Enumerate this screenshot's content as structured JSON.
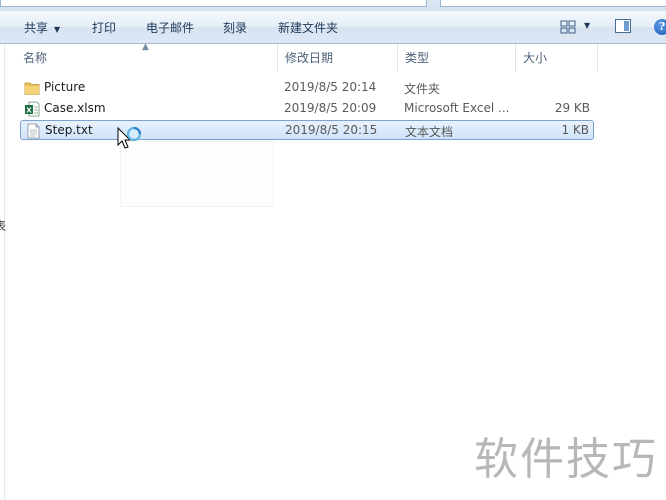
{
  "toolbar": {
    "share_label": "共享",
    "print_label": "打印",
    "email_label": "电子邮件",
    "burn_label": "刻录",
    "new_folder_label": "新建文件夹"
  },
  "columns": {
    "name": "名称",
    "date_modified": "修改日期",
    "type": "类型",
    "size": "大小"
  },
  "files": [
    {
      "name": "Picture",
      "date": "2019/8/5 20:14",
      "type": "文件夹",
      "size": "",
      "icon": "folder-icon"
    },
    {
      "name": "Case.xlsm",
      "date": "2019/8/5 20:09",
      "type": "Microsoft Excel ...",
      "size": "29 KB",
      "icon": "excel-file-icon"
    },
    {
      "name": "Step.txt",
      "date": "2019/8/5 20:15",
      "type": "文本文档",
      "size": "1 KB",
      "icon": "text-file-icon",
      "selected": true
    }
  ],
  "side_glyph": "表",
  "watermark": "软件技巧",
  "colors": {
    "selection": "#cfe3fa",
    "toolbar_text": "#1e3957",
    "excel_green": "#1d7044",
    "folder_yellow": "#e8c25a"
  }
}
